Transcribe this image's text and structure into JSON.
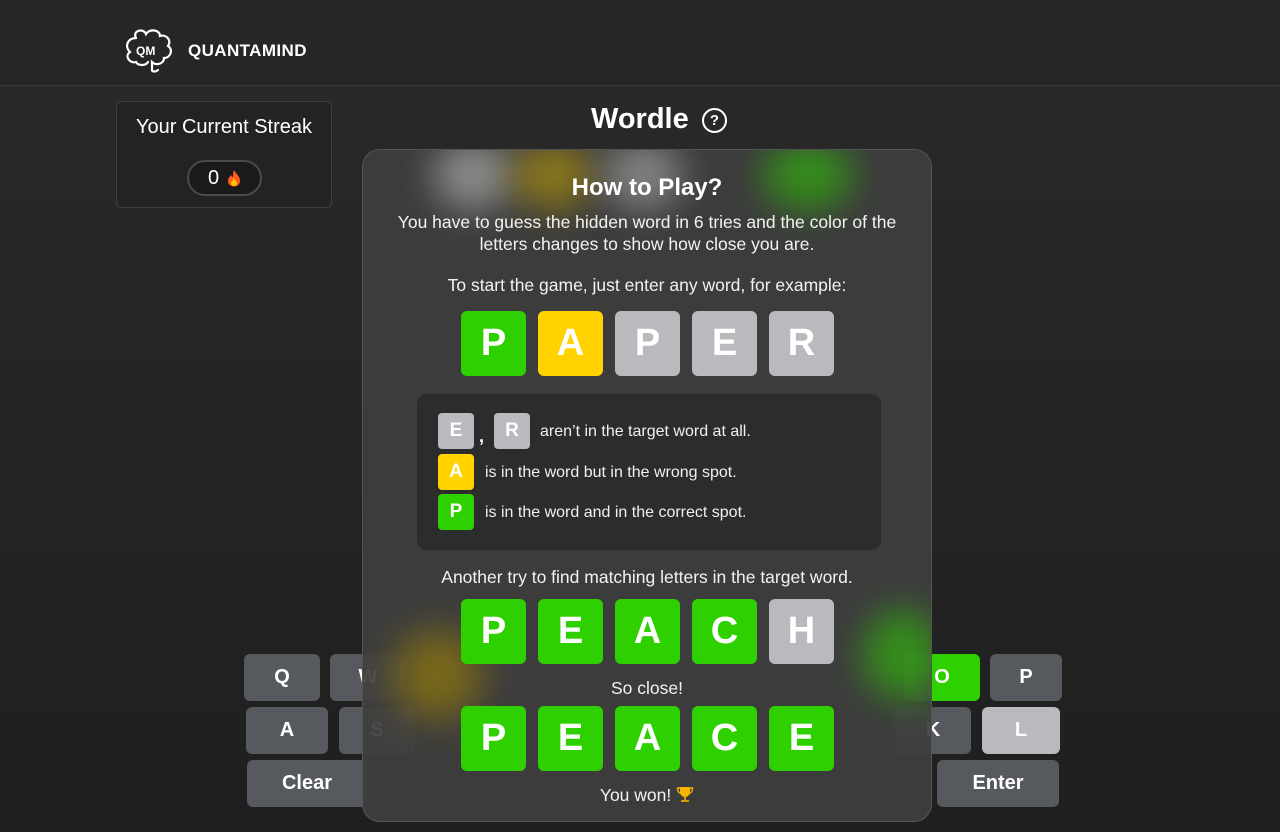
{
  "header": {
    "brand": "QUANTAMIND",
    "logo_icon": "brain-logo-icon",
    "logo_text": "QM"
  },
  "streak": {
    "title": "Your Current Streak",
    "value": "0",
    "icon": "fire-icon"
  },
  "game": {
    "title": "Wordle",
    "help_icon": "help-circle-icon",
    "help_glyph": "?"
  },
  "keyboard": {
    "row1": [
      "Q",
      "W",
      "O",
      "P"
    ],
    "row2": [
      "A",
      "S",
      "K",
      "L"
    ],
    "row3": [
      "Clear",
      "Enter"
    ]
  },
  "modal": {
    "title": "How to Play?",
    "intro": "You have to guess the hidden word in 6 tries and the color of the letters changes to show how close you are.",
    "start_text": "To start the game, just enter any word, for example:",
    "example1": [
      "P",
      "A",
      "P",
      "E",
      "R"
    ],
    "legend": {
      "absent_letters": [
        "E",
        "R"
      ],
      "absent_separator": ",",
      "absent_text": "aren’t in the target word at all.",
      "present_letter": "A",
      "present_text": "is in the word but in the wrong spot.",
      "correct_letter": "P",
      "correct_text": "is in the word and in the correct spot."
    },
    "another_try": "Another try to find matching letters in the target word.",
    "example2": [
      "P",
      "E",
      "A",
      "C",
      "H"
    ],
    "close_text": "So close!",
    "example3": [
      "P",
      "E",
      "A",
      "C",
      "E"
    ],
    "won_text": "You won!",
    "won_icon": "trophy-icon"
  },
  "colors": {
    "correct": "#2fd000",
    "present": "#ffd200",
    "absent": "#b8babd",
    "key": "#56595d",
    "background": "#252525"
  }
}
